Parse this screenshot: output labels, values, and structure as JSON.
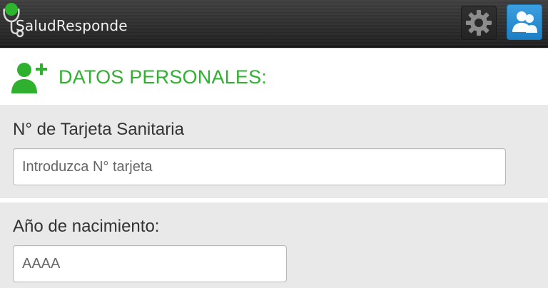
{
  "header": {
    "app_name": "SaludResponde",
    "settings_icon": "gear-icon",
    "user_icon": "users-icon",
    "colors": {
      "bar": "#2a2a2a",
      "logo_dot": "#2db52d",
      "user_button": "#2a8ad3"
    }
  },
  "section": {
    "icon": "add-user-icon",
    "title": "DATOS PERSONALES:",
    "title_color": "#2fb12f"
  },
  "form": {
    "card_field": {
      "label": "N° de Tarjeta Sanitaria",
      "placeholder": "Introduzca N° tarjeta",
      "value": ""
    },
    "birth_field": {
      "label": "Año de nacimiento:",
      "placeholder": "AAAA",
      "value": ""
    }
  }
}
